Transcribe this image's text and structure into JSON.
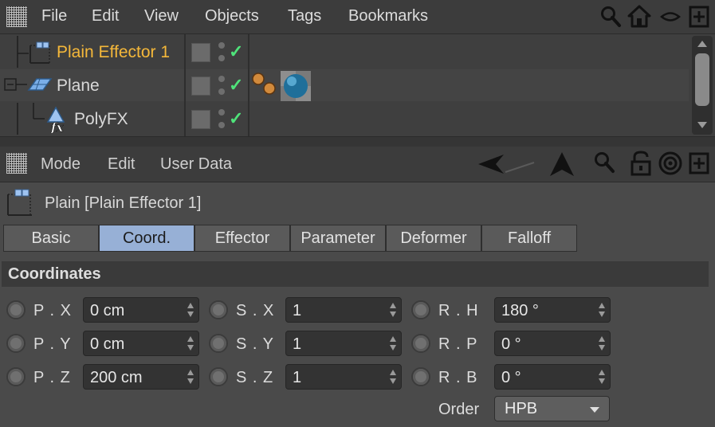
{
  "menubar": {
    "items": [
      "File",
      "Edit",
      "View",
      "Objects",
      "Tags",
      "Bookmarks"
    ],
    "icons": [
      "search-icon",
      "home-icon",
      "eye-icon",
      "new-panel-icon"
    ]
  },
  "objects": [
    {
      "name": "Plain Effector 1",
      "selected": true,
      "icon": "effector-icon"
    },
    {
      "name": "Plane",
      "selected": false,
      "icon": "plane-icon"
    },
    {
      "name": "PolyFX",
      "selected": false,
      "icon": "polyfx-icon"
    }
  ],
  "attributes": {
    "menu": [
      "Mode",
      "Edit",
      "User Data"
    ],
    "object_title": "Plain [Plain Effector 1]",
    "tabs": [
      "Basic",
      "Coord.",
      "Effector",
      "Parameter",
      "Deformer",
      "Falloff"
    ],
    "active_tab": "Coord.",
    "section": "Coordinates",
    "fields": {
      "px": {
        "label": "P . X",
        "value": "0 cm"
      },
      "py": {
        "label": "P . Y",
        "value": "0 cm"
      },
      "pz": {
        "label": "P . Z",
        "value": "200 cm"
      },
      "sx": {
        "label": "S . X",
        "value": "1"
      },
      "sy": {
        "label": "S . Y",
        "value": "1"
      },
      "sz": {
        "label": "S . Z",
        "value": "1"
      },
      "rh": {
        "label": "R . H",
        "value": "180 °"
      },
      "rp": {
        "label": "R . P",
        "value": "0 °"
      },
      "rb": {
        "label": "R . B",
        "value": "0 °"
      }
    },
    "order": {
      "label": "Order",
      "value": "HPB"
    }
  },
  "colors": {
    "selected_object": "#f5b83a",
    "active_tab": "#97b0d6",
    "check": "#4fe37a"
  }
}
